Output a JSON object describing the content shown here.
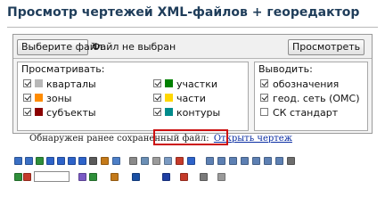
{
  "header": {
    "title": "Просмотр чертежей XML-файлов + георедактор"
  },
  "filebar": {
    "choose_label": "Выберите файл",
    "no_file_label": "Файл не выбран",
    "view_label": "Просмотреть"
  },
  "view_group": {
    "legend": "Просматривать:",
    "items": [
      {
        "label": "кварталы",
        "checked": true,
        "color": "#b8b8b8"
      },
      {
        "label": "зоны",
        "checked": true,
        "color": "#ff8c00"
      },
      {
        "label": "субъекты",
        "checked": true,
        "color": "#8b0000"
      },
      {
        "label": "участки",
        "checked": true,
        "color": "#008000"
      },
      {
        "label": "части",
        "checked": true,
        "color": "#ffd700"
      },
      {
        "label": "контуры",
        "checked": true,
        "color": "#008b8b"
      }
    ]
  },
  "output_group": {
    "legend": "Выводить:",
    "items": [
      {
        "label": "обозначения",
        "checked": true
      },
      {
        "label": "геод. сеть (ОМС)",
        "checked": true
      },
      {
        "label": "СК стандарт",
        "checked": false
      }
    ]
  },
  "notice": {
    "text": "Обнаружен ранее сохраненный файл:",
    "link": "Открыть чертеж"
  },
  "toolbar": {
    "zoom_value": "",
    "row1": [
      {
        "name": "zoom-in-icon",
        "color": "#3a6fc4"
      },
      {
        "name": "zoom-out-icon",
        "color": "#3a6fc4"
      },
      {
        "name": "zoom-fit-icon",
        "color": "#2f8f3a"
      },
      {
        "name": "arrow-left-icon",
        "color": "#2e63c9"
      },
      {
        "name": "arrow-up-icon",
        "color": "#2e63c9"
      },
      {
        "name": "arrow-down-icon",
        "color": "#2e63c9"
      },
      {
        "name": "arrow-right-icon",
        "color": "#2e63c9"
      },
      {
        "name": "pan-text-icon",
        "color": "#5a5a5a"
      },
      {
        "name": "ruler-icon",
        "color": "#c47a1a"
      },
      {
        "name": "measure-icon",
        "color": "#4d7fc7"
      },
      {
        "name": "select-area-icon",
        "color": "#8a8a8a"
      },
      {
        "name": "grid-icon",
        "color": "#6b8fb5"
      },
      {
        "name": "layer-icon",
        "color": "#9b9b9b"
      },
      {
        "name": "copy-icon",
        "color": "#7a9ac2"
      },
      {
        "name": "delete-icon",
        "color": "#c43a2a"
      },
      {
        "name": "undo-icon",
        "color": "#2e63c9"
      },
      {
        "name": "table-icon",
        "color": "#5d80b3"
      },
      {
        "name": "list-icon",
        "color": "#5d80b3"
      },
      {
        "name": "frame-icon",
        "color": "#5d80b3"
      },
      {
        "name": "window-icon",
        "color": "#5d80b3"
      },
      {
        "name": "split-icon",
        "color": "#5d80b3"
      },
      {
        "name": "merge-icon",
        "color": "#5d80b3"
      },
      {
        "name": "overlap-icon",
        "color": "#5d80b3"
      },
      {
        "name": "print-icon",
        "color": "#6d6d6d"
      }
    ],
    "row2": [
      {
        "name": "edit-icon",
        "color": "#2f8f3a"
      },
      {
        "name": "node-icon",
        "color": "#c43a2a"
      },
      {
        "name": "line-icon",
        "color": "#7a5ac4"
      },
      {
        "name": "polygon-icon",
        "color": "#2f8f3a"
      },
      {
        "name": "point-icon",
        "color": "#c47a1a"
      },
      {
        "name": "text-icon",
        "color": "#1a4fa3"
      },
      {
        "name": "save-icon",
        "color": "#1f3fa3"
      },
      {
        "name": "export-icon",
        "color": "#c43a2a"
      },
      {
        "name": "import-icon",
        "color": "#7a7a7a"
      },
      {
        "name": "settings-icon",
        "color": "#9a9a9a"
      }
    ]
  }
}
